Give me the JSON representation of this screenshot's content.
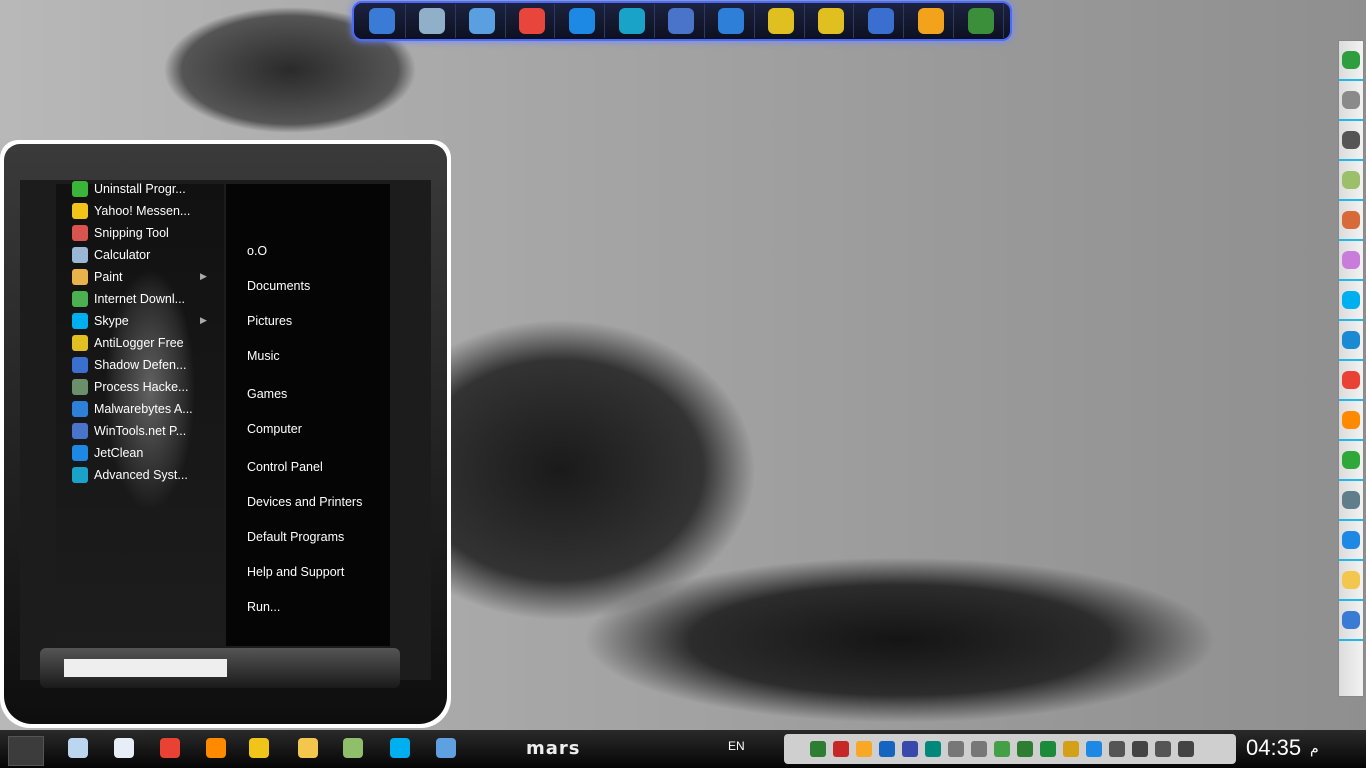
{
  "dock": {
    "icons": [
      "computer-icon",
      "recycle-bin-icon",
      "control-panel-icon",
      "ccleaner-icon",
      "jetclean-icon",
      "advanced-systemcare-icon",
      "wintools-icon",
      "malwarebytes-icon",
      "zemana-icon",
      "zemana-antilogger-icon",
      "shadow-defender-icon",
      "windows-icon",
      "task-manager-icon"
    ]
  },
  "sidebar": {
    "icons": [
      "grid-icon",
      "snipping-icon",
      "usb-icon",
      "notes-icon",
      "puzzle-icon",
      "messenger-icon",
      "skype-icon",
      "teamviewer-icon",
      "chrome-icon",
      "firefox-icon",
      "uninstall-icon",
      "drive-icon",
      "disc-icon",
      "folder-icon",
      "image-icon"
    ]
  },
  "start_menu": {
    "programs": [
      {
        "label": "Uninstall Progr...",
        "icon": "uninstall-icon",
        "color": "#3ab53a",
        "submenu": false
      },
      {
        "label": "Yahoo! Messen...",
        "icon": "yahoo-messenger-icon",
        "color": "#f0c419",
        "submenu": false
      },
      {
        "label": "Snipping Tool",
        "icon": "snipping-tool-icon",
        "color": "#d9534f",
        "submenu": false
      },
      {
        "label": "Calculator",
        "icon": "calculator-icon",
        "color": "#9ab8d6",
        "submenu": false
      },
      {
        "label": "Paint",
        "icon": "paint-icon",
        "color": "#e8b34a",
        "submenu": true
      },
      {
        "label": "Internet Downl...",
        "icon": "internet-download-manager-icon",
        "color": "#4caf50",
        "submenu": false
      },
      {
        "label": "Skype",
        "icon": "skype-icon",
        "color": "#00aff0",
        "submenu": true
      },
      {
        "label": "AntiLogger Free",
        "icon": "antilogger-icon",
        "color": "#e0c020",
        "submenu": false
      },
      {
        "label": "Shadow Defen...",
        "icon": "shadow-defender-icon",
        "color": "#3a6fd0",
        "submenu": false
      },
      {
        "label": "Process Hacke...",
        "icon": "process-hacker-icon",
        "color": "#6b8e6b",
        "submenu": false
      },
      {
        "label": "Malwarebytes A...",
        "icon": "malwarebytes-icon",
        "color": "#2d7fd8",
        "submenu": false
      },
      {
        "label": "WinTools.net P...",
        "icon": "wintools-icon",
        "color": "#4a74c9",
        "submenu": false
      },
      {
        "label": "JetClean",
        "icon": "jetclean-icon",
        "color": "#1e88e5",
        "submenu": false
      },
      {
        "label": "Advanced Syst...",
        "icon": "advanced-systemcare-icon",
        "color": "#1aa3c9",
        "submenu": false
      }
    ],
    "places": [
      {
        "label": "o.O",
        "name": "user-folder-link"
      },
      {
        "label": "Documents",
        "name": "documents-link"
      },
      {
        "label": "Pictures",
        "name": "pictures-link"
      },
      {
        "label": "Music",
        "name": "music-link"
      },
      {
        "label": "Games",
        "name": "games-link"
      },
      {
        "label": "Computer",
        "name": "computer-link"
      },
      {
        "label": "Control Panel",
        "name": "control-panel-link"
      },
      {
        "label": "Devices and Printers",
        "name": "devices-printers-link"
      },
      {
        "label": "Default Programs",
        "name": "default-programs-link"
      },
      {
        "label": "Help and Support",
        "name": "help-support-link"
      },
      {
        "label": "Run...",
        "name": "run-link"
      }
    ]
  },
  "taskbar": {
    "pinned": [
      {
        "icon": "notepad-icon",
        "color": "#bcd6ef"
      },
      {
        "icon": "document-icon",
        "color": "#e8eef7"
      },
      {
        "icon": "chrome-icon",
        "color": "#e94235"
      },
      {
        "icon": "firefox-icon",
        "color": "#ff8a00"
      },
      {
        "icon": "yahoo-messenger-icon",
        "color": "#f0c419"
      },
      {
        "icon": "explorer-icon",
        "color": "#f3c74d"
      },
      {
        "icon": "network-icon",
        "color": "#8fbf6a"
      },
      {
        "icon": "skype-icon",
        "color": "#00aff0"
      },
      {
        "icon": "teamviewer-icon",
        "color": "#5ea0e0"
      }
    ],
    "brand": "mars",
    "language": "EN",
    "tray_icons": [
      "cpu-meter-icon",
      "network-graph-icon",
      "norton-icon",
      "bluetooth-icon",
      "wintools-tray-icon",
      "sync-icon",
      "messenger-tray-icon",
      "messenger2-tray-icon",
      "share-icon",
      "check-icon",
      "excel-icon",
      "zemana-tray-icon",
      "malwarebytes-tray-icon",
      "flag-icon",
      "battery-icon",
      "signal-icon",
      "volume-icon"
    ],
    "clock": "04:35",
    "ampm": "م"
  },
  "colors": {
    "accent": "#4a6bff",
    "tray_separator": "#23b7e8"
  }
}
